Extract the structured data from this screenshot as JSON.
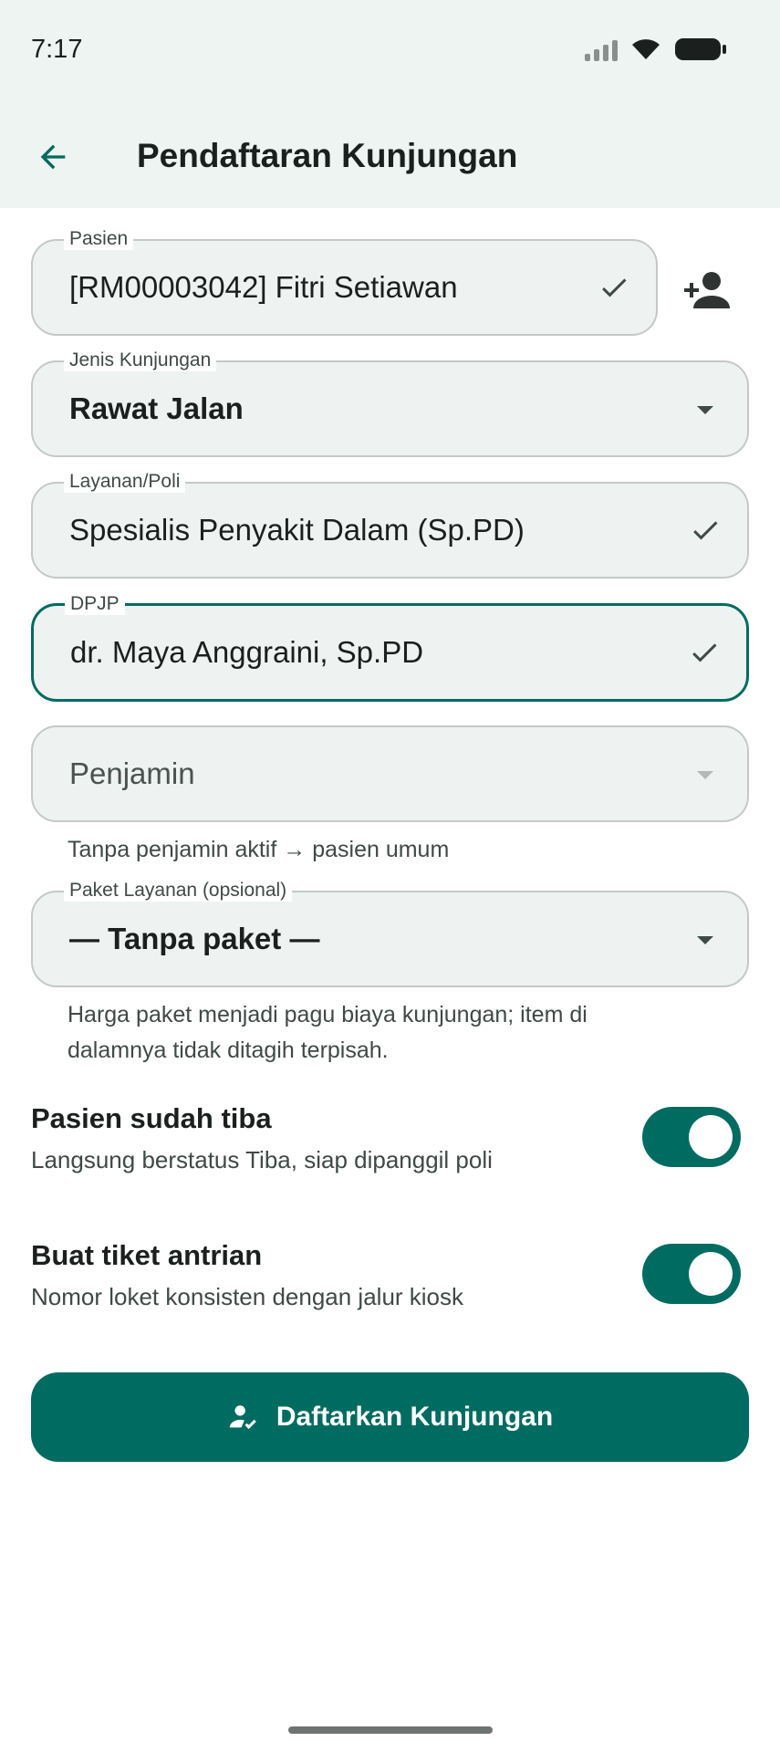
{
  "status_bar": {
    "time": "7:17"
  },
  "header": {
    "title": "Pendaftaran Kunjungan"
  },
  "form": {
    "pasien": {
      "label": "Pasien",
      "value": "[RM00003042] Fitri Setiawan"
    },
    "jenis_kunjungan": {
      "label": "Jenis Kunjungan",
      "value": "Rawat Jalan"
    },
    "layanan_poli": {
      "label": "Layanan/Poli",
      "value": "Spesialis Penyakit Dalam (Sp.PD)"
    },
    "dpjp": {
      "label": "DPJP",
      "value": "dr. Maya Anggraini, Sp.PD"
    },
    "penjamin": {
      "placeholder": "Penjamin",
      "helper": "Tanpa penjamin aktif → pasien umum"
    },
    "paket_layanan": {
      "label": "Paket Layanan (opsional)",
      "value": "— Tanpa paket —",
      "helper_line1": "Harga paket menjadi pagu biaya kunjungan; item di",
      "helper_line2": "dalamnya tidak ditagih terpisah."
    }
  },
  "toggles": {
    "arrived": {
      "title": "Pasien sudah tiba",
      "subtitle": "Langsung berstatus Tiba, siap dipanggil poli",
      "on": true
    },
    "ticket": {
      "title": "Buat tiket antrian",
      "subtitle": "Nomor loket konsisten dengan jalur kiosk",
      "on": true
    }
  },
  "submit": {
    "label": "Daftarkan Kunjungan"
  },
  "colors": {
    "accent": "#006b60",
    "field_bg": "#eef3f1",
    "header_bg": "#eef4f1"
  }
}
